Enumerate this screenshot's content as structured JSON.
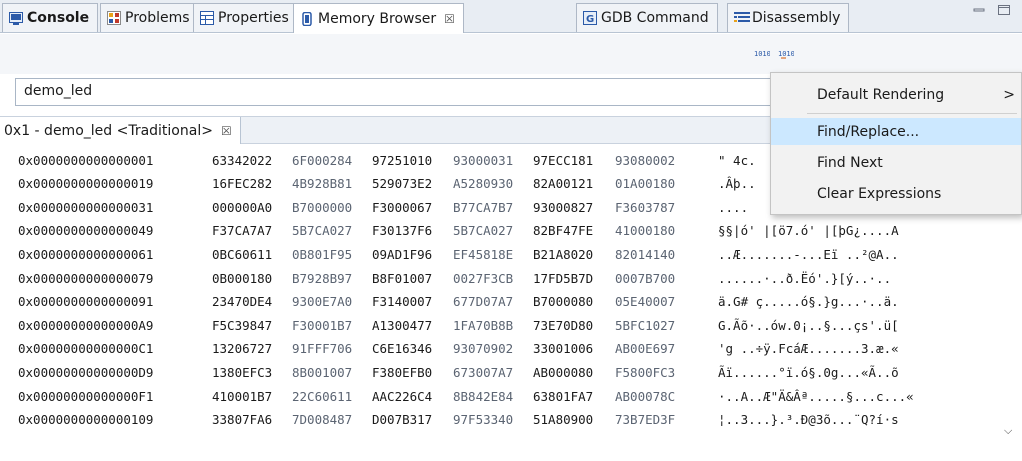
{
  "tabs": [
    {
      "label": "Console",
      "icon": "console-icon",
      "active": false
    },
    {
      "label": "Problems",
      "icon": "problems-icon",
      "active": false
    },
    {
      "label": "Properties",
      "icon": "properties-icon",
      "active": false
    },
    {
      "label": "Memory Browser",
      "icon": "memory-icon",
      "active": true,
      "close": "☒"
    },
    {
      "label": "GDB Command",
      "icon": "gdb-icon",
      "active": false
    },
    {
      "label": "Disassembly",
      "icon": "disassembly-icon",
      "active": false
    }
  ],
  "expression": {
    "value": "demo_led"
  },
  "rendering_tab": {
    "label": "0x1 - demo_led <Traditional>",
    "close": "☒"
  },
  "rows": [
    {
      "addr": "0x0000000000000001",
      "words": [
        "63342022",
        "6F000284",
        "97251010",
        "93000031",
        "97ECC181",
        "93080002"
      ],
      "ascii": "\" 4c."
    },
    {
      "addr": "0x0000000000000019",
      "words": [
        "16FEC282",
        "4B928B81",
        "529073E2",
        "A5280930",
        "82A00121",
        "01A00180"
      ],
      "ascii": ".Âþ.."
    },
    {
      "addr": "0x0000000000000031",
      "words": [
        "000000A0",
        "B7000000",
        "F3000067",
        "B77CA7B7",
        "93000827",
        "F3603787"
      ],
      "ascii": "  ...."
    },
    {
      "addr": "0x0000000000000049",
      "words": [
        "F37CA7A7",
        "5B7CA027",
        "F30137F6",
        "5B7CA027",
        "82BF47FE",
        "41000180"
      ],
      "ascii": "§§|ó' |[ö7.ó' |[þG¿....A"
    },
    {
      "addr": "0x0000000000000061",
      "words": [
        "0BC60611",
        "0B801F95",
        "09AD1F96",
        "EF45818E",
        "B21A8020",
        "82014140"
      ],
      "ascii": "..Æ.......-...Eï ..²@A.."
    },
    {
      "addr": "0x0000000000000079",
      "words": [
        "0B000180",
        "B7928B97",
        "B8F01007",
        "0027F3CB",
        "17FD5B7D",
        "0007B700"
      ],
      "ascii": "......·..ð.Ëó'.}[ý..·.."
    },
    {
      "addr": "0x0000000000000091",
      "words": [
        "23470DE4",
        "9300E7A0",
        "F3140007",
        "677D07A7",
        "B7000080",
        "05E40007"
      ],
      "ascii": "ä.G# ç.....ó§.}g...·..ä."
    },
    {
      "addr": "0x00000000000000A9",
      "words": [
        "F5C39847",
        "F30001B7",
        "A1300477",
        "1FA70B8B",
        "73E70D80",
        "5BFC1027"
      ],
      "ascii": "G.Ãõ·..ów.0¡..§...çs'.ü["
    },
    {
      "addr": "0x00000000000000C1",
      "words": [
        "13206727",
        "91FFF706",
        "C6E16346",
        "93070902",
        "33001006",
        "AB00E697"
      ],
      "ascii": "'g ..÷ÿ.FcáÆ.......3.æ.«"
    },
    {
      "addr": "0x00000000000000D9",
      "words": [
        "1380EFC3",
        "8B001007",
        "F380EFB0",
        "673007A7",
        "AB000080",
        "F5800FC3"
      ],
      "ascii": "Ãï......°ï.ó§.0g...«Ã..õ"
    },
    {
      "addr": "0x00000000000000F1",
      "words": [
        "410001B7",
        "22C60611",
        "AAC226C4",
        "8B842E84",
        "63801FA7",
        "AB00078C"
      ],
      "ascii": "·..A..Æ\"Ä&Âª.....§...c...«"
    },
    {
      "addr": "0x0000000000000109",
      "words": [
        "33807FA6",
        "7D008487",
        "D007B317",
        "97F53340",
        "51A80900",
        "73B7ED3F"
      ],
      "ascii": "¦..3...}.³.Ð@3õ...¨Q?í·s"
    }
  ],
  "menu": {
    "items": [
      {
        "label": "Default Rendering",
        "submenu": true,
        "highlighted": false
      },
      {
        "label": "Find/Replace...",
        "submenu": false,
        "highlighted": true
      },
      {
        "label": "Find Next",
        "submenu": false,
        "highlighted": false
      },
      {
        "label": "Clear Expressions",
        "submenu": false,
        "highlighted": false
      }
    ],
    "submenu_arrow": ">"
  },
  "colors": {
    "tab_bg": "#e8edf3",
    "menu_highlight": "#cce8ff",
    "light_hex": "#5b6472"
  }
}
